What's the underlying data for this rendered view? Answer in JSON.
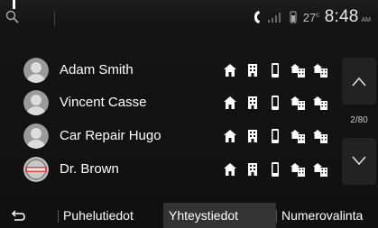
{
  "status": {
    "temperature": "27",
    "temperature_unit": "c",
    "time": "8:48",
    "ampm": "AM"
  },
  "contacts": [
    {
      "name": "Adam Smith",
      "avatar": "person-avatar"
    },
    {
      "name": "Vincent Casse",
      "avatar": "person-avatar"
    },
    {
      "name": "Car Repair Hugo",
      "avatar": "person-avatar"
    },
    {
      "name": "Dr. Brown",
      "avatar": "brand-logo-avatar"
    }
  ],
  "contact_icons": [
    "home-icon",
    "office-phone-icon",
    "mobile-phone-icon",
    "home-work-icon",
    "home-work-icon"
  ],
  "pagination": {
    "indicator": "2/80"
  },
  "tabs": [
    {
      "label": "Puhelutiedot",
      "active": false
    },
    {
      "label": "Yhteystiedot",
      "active": true
    },
    {
      "label": "Numerovalinta",
      "active": false
    }
  ],
  "colors": {
    "background": "#101010",
    "tab_active_bg": "#333333",
    "panel_bg": "#222222"
  }
}
